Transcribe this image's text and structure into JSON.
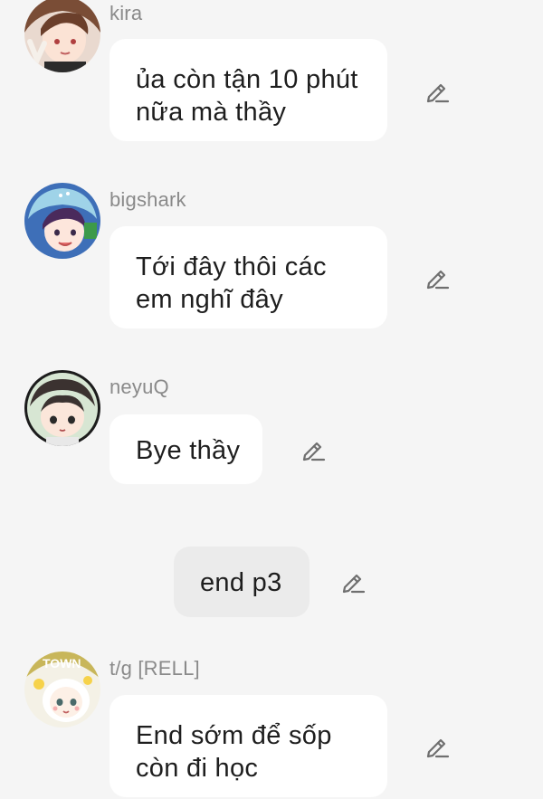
{
  "messages": [
    {
      "username": "kira",
      "lines": [
        "ủa còn tận 10 phút",
        "nữa mà thầy"
      ],
      "edit_icon": "pencil-icon"
    },
    {
      "username": "bigshark",
      "lines": [
        "Tới đây thôi các",
        "em nghĩ đây"
      ],
      "edit_icon": "pencil-icon"
    },
    {
      "username": "neyuQ",
      "lines": [
        "Bye thầy"
      ],
      "edit_icon": "pencil-icon"
    },
    {
      "type": "system",
      "lines": [
        "end p3"
      ],
      "edit_icon": "pencil-icon"
    },
    {
      "username": "t/g [RELL]",
      "avatar_text": "TOWN",
      "lines": [
        "End sớm để sốp",
        "còn đi học"
      ],
      "edit_icon": "pencil-icon"
    }
  ],
  "colors": {
    "background": "#f5f5f5",
    "bubble": "#ffffff",
    "system_bubble": "#ebebeb",
    "username": "#8a8a8a",
    "text": "#1e1e1e",
    "icon": "#6f6f6f"
  }
}
